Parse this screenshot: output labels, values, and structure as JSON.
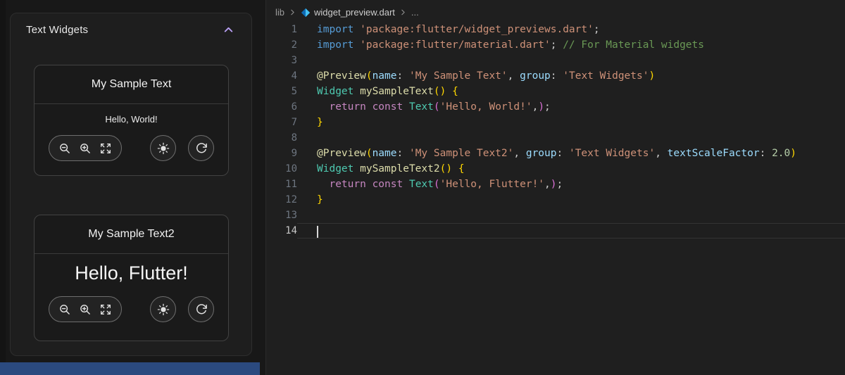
{
  "sidebar": {
    "section_title": "Text Widgets",
    "cards": [
      {
        "title": "My Sample Text",
        "content": "Hello, World!"
      },
      {
        "title": "My Sample Text2",
        "content": "Hello, Flutter!"
      }
    ],
    "toolbar_icons": [
      "zoom-out-icon",
      "zoom-in-icon",
      "expand-icon",
      "brightness-icon",
      "refresh-icon"
    ],
    "accent_color": "#b9a0f5",
    "statusbar_color": "#2b4a7f"
  },
  "editor": {
    "breadcrumb": {
      "folder": "lib",
      "file": "widget_preview.dart",
      "more": "..."
    },
    "active_line": 14,
    "cursor_line": 14,
    "colors": {
      "kw": "#569cd6",
      "ctl": "#c586c0",
      "str": "#ce9178",
      "com": "#6a9955",
      "fn": "#dcdcaa",
      "type": "#4ec9b0",
      "prop": "#9cdcfe",
      "num": "#b5cea8",
      "pln": "#cccccc",
      "b1": "#ffd700",
      "b2": "#da70d6"
    },
    "lines": [
      [
        {
          "t": "import ",
          "c": "kw"
        },
        {
          "t": "'package:flutter/widget_previews.dart'",
          "c": "str"
        },
        {
          "t": ";",
          "c": "pln"
        }
      ],
      [
        {
          "t": "import ",
          "c": "kw"
        },
        {
          "t": "'package:flutter/material.dart'",
          "c": "str"
        },
        {
          "t": "; ",
          "c": "pln"
        },
        {
          "t": "// For Material widgets",
          "c": "com"
        }
      ],
      [],
      [
        {
          "t": "@Preview",
          "c": "fn"
        },
        {
          "t": "(",
          "c": "b1"
        },
        {
          "t": "name",
          "c": "prop"
        },
        {
          "t": ": ",
          "c": "pln"
        },
        {
          "t": "'My Sample Text'",
          "c": "str"
        },
        {
          "t": ", ",
          "c": "pln"
        },
        {
          "t": "group",
          "c": "prop"
        },
        {
          "t": ": ",
          "c": "pln"
        },
        {
          "t": "'Text Widgets'",
          "c": "str"
        },
        {
          "t": ")",
          "c": "b1"
        }
      ],
      [
        {
          "t": "Widget ",
          "c": "type"
        },
        {
          "t": "mySampleText",
          "c": "fn"
        },
        {
          "t": "()",
          "c": "b1"
        },
        {
          "t": " ",
          "c": "pln"
        },
        {
          "t": "{",
          "c": "b1"
        }
      ],
      [
        {
          "t": "  ",
          "c": "pln"
        },
        {
          "t": "return ",
          "c": "ctl"
        },
        {
          "t": "const ",
          "c": "ctl"
        },
        {
          "t": "Text",
          "c": "type"
        },
        {
          "t": "(",
          "c": "b2"
        },
        {
          "t": "'Hello, World!'",
          "c": "str"
        },
        {
          "t": ",",
          "c": "pln"
        },
        {
          "t": ")",
          "c": "b2"
        },
        {
          "t": ";",
          "c": "pln"
        }
      ],
      [
        {
          "t": "}",
          "c": "b1"
        }
      ],
      [],
      [
        {
          "t": "@Preview",
          "c": "fn"
        },
        {
          "t": "(",
          "c": "b1"
        },
        {
          "t": "name",
          "c": "prop"
        },
        {
          "t": ": ",
          "c": "pln"
        },
        {
          "t": "'My Sample Text2'",
          "c": "str"
        },
        {
          "t": ", ",
          "c": "pln"
        },
        {
          "t": "group",
          "c": "prop"
        },
        {
          "t": ": ",
          "c": "pln"
        },
        {
          "t": "'Text Widgets'",
          "c": "str"
        },
        {
          "t": ", ",
          "c": "pln"
        },
        {
          "t": "textScaleFactor",
          "c": "prop"
        },
        {
          "t": ": ",
          "c": "pln"
        },
        {
          "t": "2.0",
          "c": "num"
        },
        {
          "t": ")",
          "c": "b1"
        }
      ],
      [
        {
          "t": "Widget ",
          "c": "type"
        },
        {
          "t": "mySampleText2",
          "c": "fn"
        },
        {
          "t": "()",
          "c": "b1"
        },
        {
          "t": " ",
          "c": "pln"
        },
        {
          "t": "{",
          "c": "b1"
        }
      ],
      [
        {
          "t": "  ",
          "c": "pln"
        },
        {
          "t": "return ",
          "c": "ctl"
        },
        {
          "t": "const ",
          "c": "ctl"
        },
        {
          "t": "Text",
          "c": "type"
        },
        {
          "t": "(",
          "c": "b2"
        },
        {
          "t": "'Hello, Flutter!'",
          "c": "str"
        },
        {
          "t": ",",
          "c": "pln"
        },
        {
          "t": ")",
          "c": "b2"
        },
        {
          "t": ";",
          "c": "pln"
        }
      ],
      [
        {
          "t": "}",
          "c": "b1"
        }
      ],
      [],
      []
    ]
  }
}
